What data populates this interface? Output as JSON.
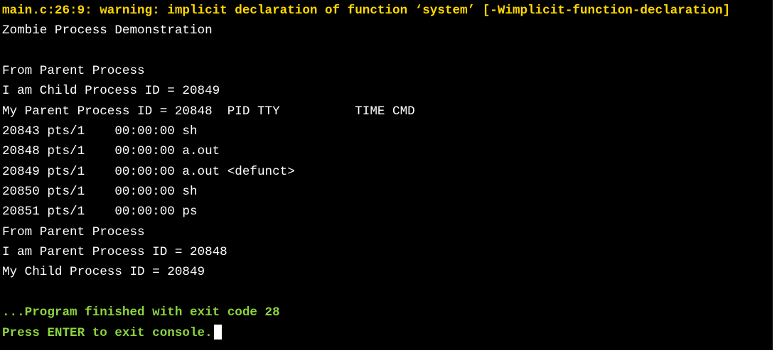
{
  "terminal": {
    "warning_line": "main.c:26:9: warning: implicit declaration of function ‘system’ [-Wimplicit-function-declaration]",
    "output_lines": [
      "Zombie Process Demonstration",
      "",
      "From Parent Process",
      "I am Child Process ID = 20849",
      "My Parent Process ID = 20848  PID TTY          TIME CMD",
      "20843 pts/1    00:00:00 sh",
      "20848 pts/1    00:00:00 a.out",
      "20849 pts/1    00:00:00 a.out <defunct>",
      "20850 pts/1    00:00:00 sh",
      "20851 pts/1    00:00:00 ps",
      "From Parent Process",
      "I am Parent Process ID = 20848",
      "My Child Process ID = 20849",
      ""
    ],
    "finished_line": "...Program finished with exit code 28",
    "prompt_line": "Press ENTER to exit console.",
    "colors": {
      "background": "#000000",
      "text": "#ffffff",
      "warning": "#ffd700",
      "finished": "#8cd43c"
    }
  }
}
